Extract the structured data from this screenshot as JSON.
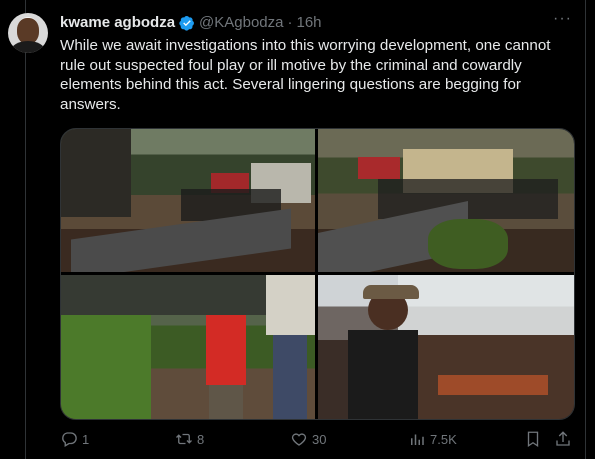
{
  "tweet": {
    "author_name": "kwame agbodza",
    "handle": "@KAgbodza",
    "separator": "·",
    "time": "16h",
    "text": "While we await investigations into this worrying development, one cannot rule out suspected foul play or ill motive by the criminal and cowardly elements behind this act. Several lingering questions are begging for answers.",
    "more": "···"
  },
  "actions": {
    "replies": "1",
    "reposts": "8",
    "likes": "30",
    "views": "7.5K"
  },
  "colors": {
    "accent": "#1d9bf0",
    "text": "#e7e9ea",
    "muted": "#71767b",
    "border": "#2f3336",
    "bg": "#000000"
  },
  "icons": [
    "verified-icon",
    "more-icon",
    "reply-icon",
    "repost-icon",
    "like-icon",
    "views-icon",
    "bookmark-icon",
    "share-icon"
  ]
}
